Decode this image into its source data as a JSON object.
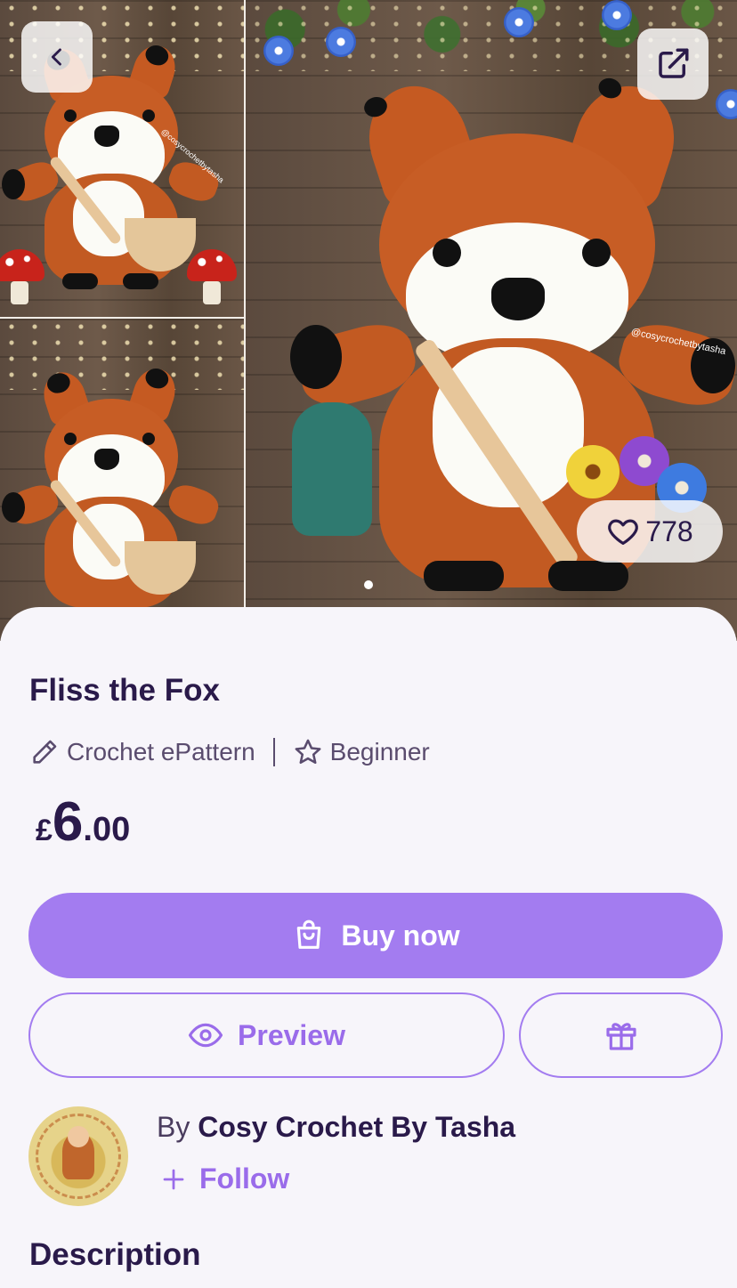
{
  "hero": {
    "watermark_small": "@cosycrochetbytasha",
    "watermark_main": "@cosycrochetbytasha",
    "like_count": "778",
    "image_count": 1
  },
  "product": {
    "title": "Fliss the Fox",
    "type": "Crochet ePattern",
    "difficulty": "Beginner",
    "price": {
      "currency": "£",
      "major": "6",
      "minor": ".00"
    }
  },
  "actions": {
    "buy_label": "Buy now",
    "preview_label": "Preview"
  },
  "designer": {
    "by_prefix": "By",
    "name": "Cosy Crochet By Tasha",
    "follow_label": "Follow"
  },
  "sections": {
    "description_title": "Description"
  },
  "colors": {
    "accent": "#a37cf0",
    "text_dark": "#2a1a4a",
    "background": "#f7f5fa"
  },
  "icons": [
    "back-icon",
    "share-icon",
    "heart-icon",
    "pen-icon",
    "star-icon",
    "shopping-bag-icon",
    "eye-icon",
    "gift-icon",
    "plus-icon"
  ]
}
